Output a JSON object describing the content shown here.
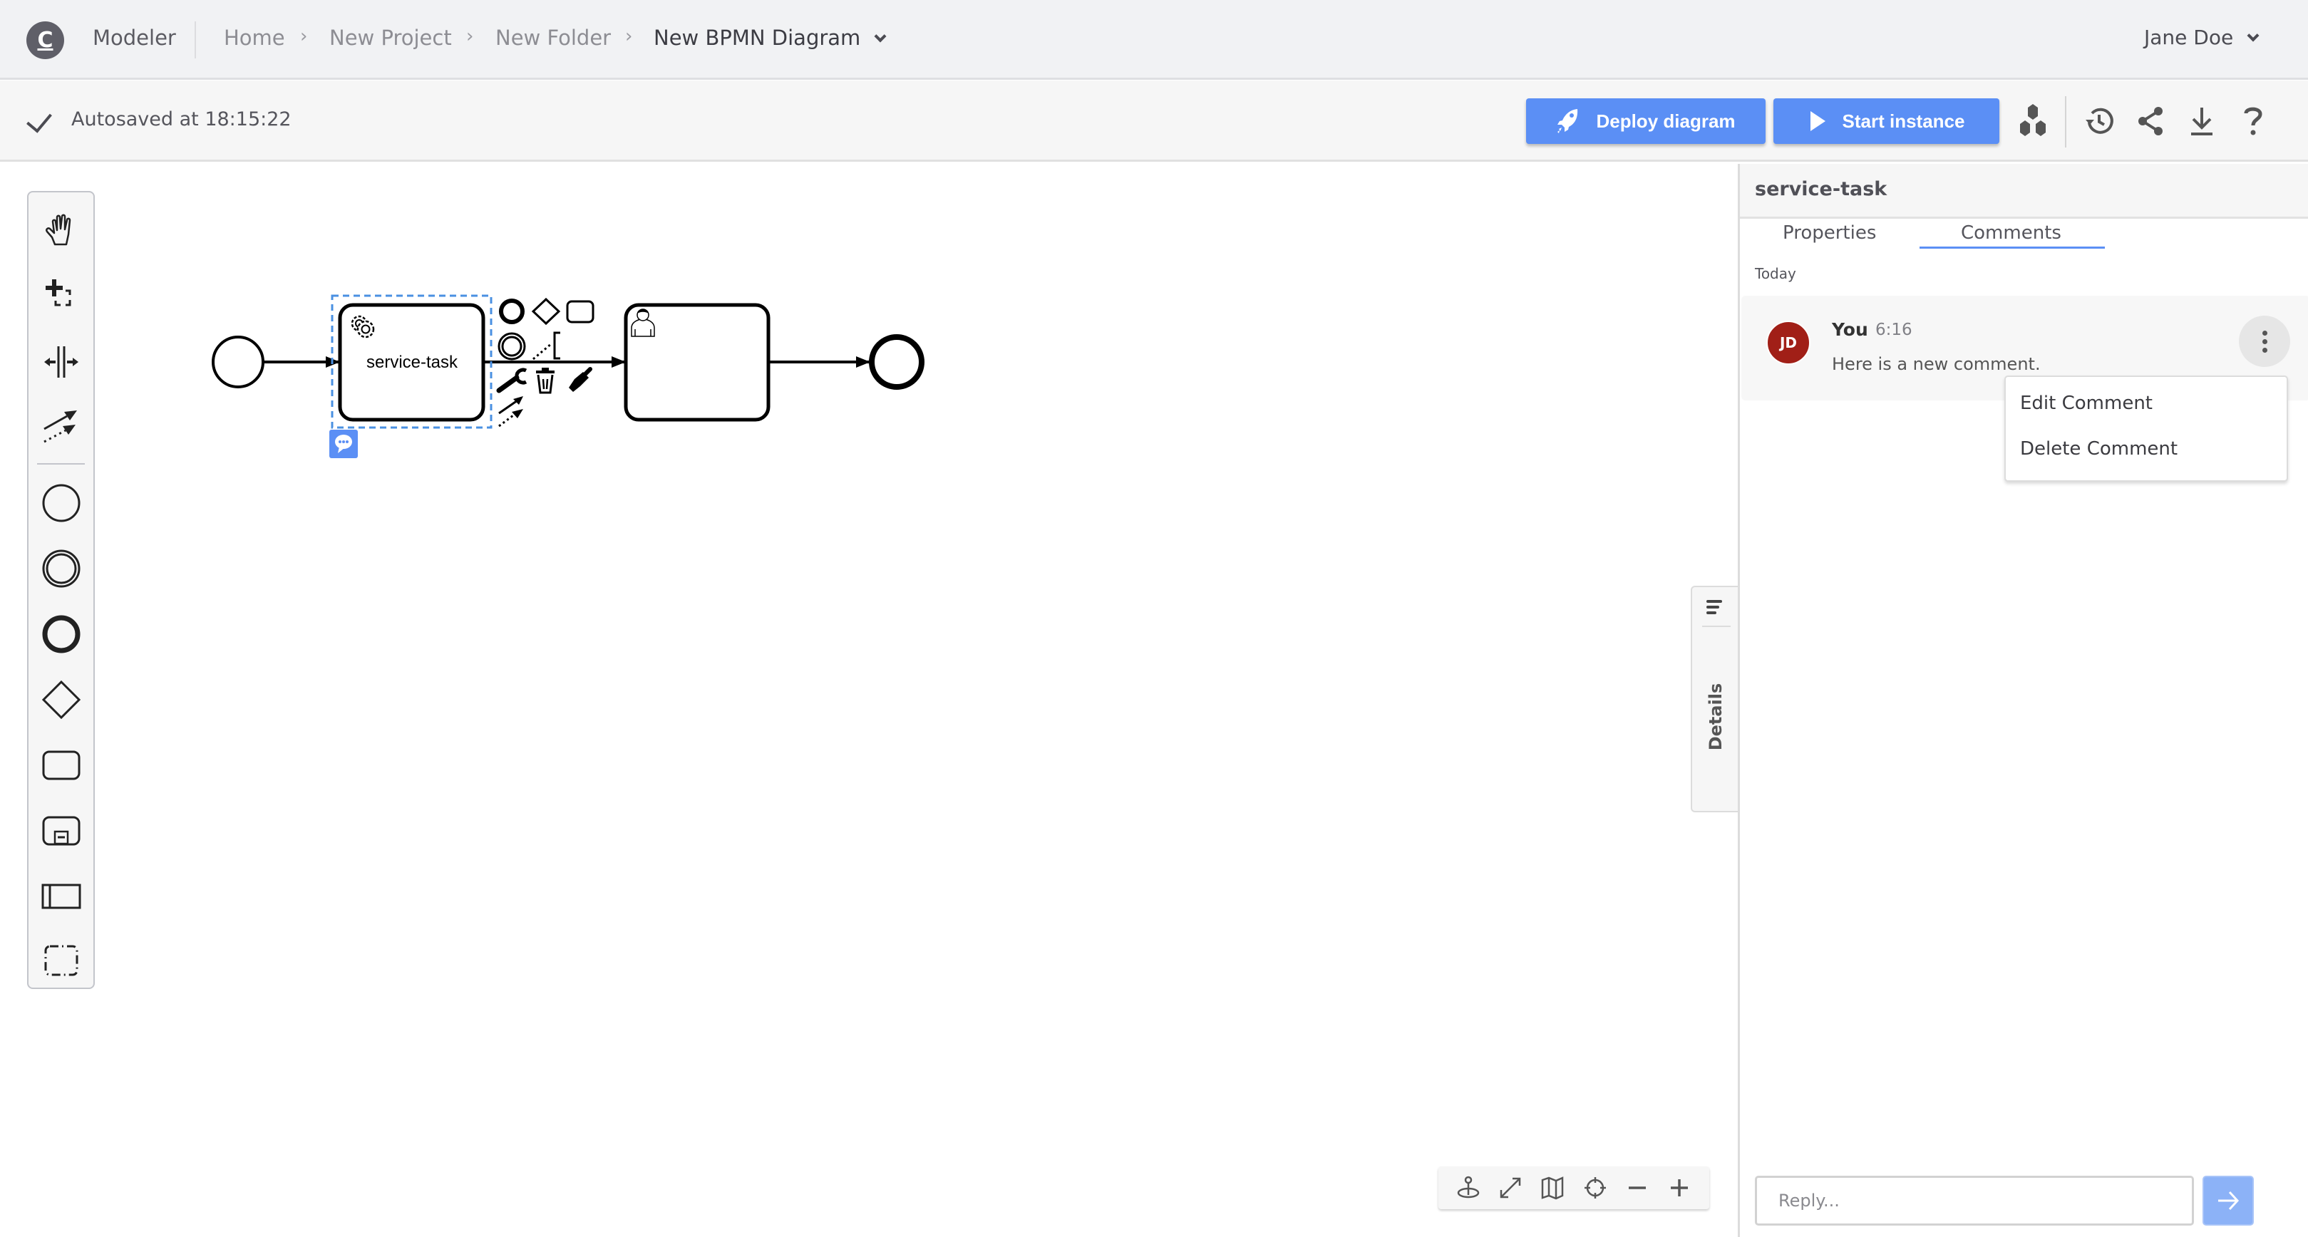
{
  "header": {
    "logo_letter": "C",
    "app_name": "Modeler",
    "breadcrumbs": [
      {
        "label": "Home"
      },
      {
        "label": "New Project"
      },
      {
        "label": "New Folder"
      },
      {
        "label": "New BPMN Diagram"
      }
    ],
    "breadcrumb_separator": "›",
    "user_name": "Jane Doe"
  },
  "toolbar": {
    "autosave_text": "Autosaved at 18:15:22",
    "deploy_label": "Deploy diagram",
    "start_label": "Start instance",
    "icons": [
      "rocket-icon",
      "play-icon",
      "hexagons-icon",
      "history-icon",
      "share-icon",
      "download-icon",
      "help-icon"
    ],
    "accent_color": "#5b8ff5"
  },
  "palette": {
    "tools": [
      "hand-tool",
      "lasso-tool",
      "space-tool",
      "global-connect-tool"
    ],
    "shapes": [
      "start-event",
      "intermediate-event",
      "end-event",
      "gateway",
      "task",
      "subprocess",
      "pool",
      "group"
    ]
  },
  "diagram": {
    "elements": [
      {
        "type": "start-event",
        "label": ""
      },
      {
        "type": "service-task",
        "label": "service-task",
        "selected": true,
        "has_comments": true
      },
      {
        "type": "user-task",
        "label": ""
      },
      {
        "type": "end-event",
        "label": ""
      }
    ],
    "context_pad": [
      "append-end-event",
      "append-gateway",
      "append-task",
      "append-intermediate-event",
      "append-text-annotation",
      "change-type",
      "delete",
      "color",
      "connect"
    ]
  },
  "details_tab": {
    "label": "Details"
  },
  "zoom_controls": [
    "reset-view-icon",
    "fit-icon",
    "minimap-icon",
    "center-icon",
    "zoom-out-icon",
    "zoom-in-icon"
  ],
  "panel": {
    "title": "service-task",
    "tabs": [
      {
        "label": "Properties",
        "active": false
      },
      {
        "label": "Comments",
        "active": true
      }
    ],
    "date_group": "Today",
    "comments": [
      {
        "initials": "JD",
        "author": "You",
        "time": "6:16",
        "text": "Here is a new comment.",
        "avatar_color": "#a11f17"
      }
    ],
    "comment_menu": [
      "Edit Comment",
      "Delete Comment"
    ],
    "reply_placeholder": "Reply...",
    "reply_value": ""
  }
}
